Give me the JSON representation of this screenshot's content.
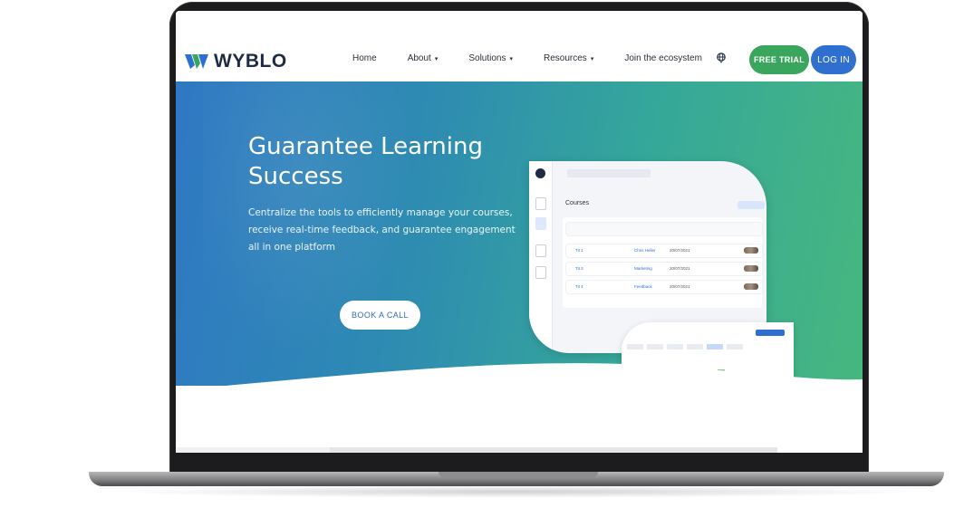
{
  "brand": {
    "logo_text": "WYBLO",
    "logo_colors": [
      "#2f6fd0",
      "#3aa55c"
    ]
  },
  "nav": {
    "links": [
      {
        "label": "Home",
        "dropdown": false
      },
      {
        "label": "About",
        "dropdown": true
      },
      {
        "label": "Solutions",
        "dropdown": true
      },
      {
        "label": "Resources",
        "dropdown": true
      },
      {
        "label": "Join the ecosystem",
        "dropdown": false
      }
    ],
    "globe_icon": "globe-icon",
    "trial_label": "FREE TRIAL",
    "login_label": "LOG IN"
  },
  "hero": {
    "title_line1": "Guarantee Learning",
    "title_line2": "Success",
    "subtitle": "Centralize the tools to efficiently manage your courses, receive real-time feedback, and guarantee engagement all in one platform",
    "cta_label": "BOOK A CALL"
  },
  "mockup": {
    "courses_title": "Courses",
    "rows": [
      {
        "name": "Tit 1",
        "link": "Chris Heller",
        "date": "20/07/2021"
      },
      {
        "name": "Tit 3",
        "link": "Marketing",
        "date": "20/07/2021"
      },
      {
        "name": "Tit 4",
        "link": "Feedback",
        "date": "20/07/2021"
      }
    ]
  },
  "colors": {
    "hero_gradient_start": "#2f78c3",
    "hero_gradient_end": "#47b77f",
    "trial_button": "#3aa55c",
    "login_button": "#2f6fd0"
  }
}
